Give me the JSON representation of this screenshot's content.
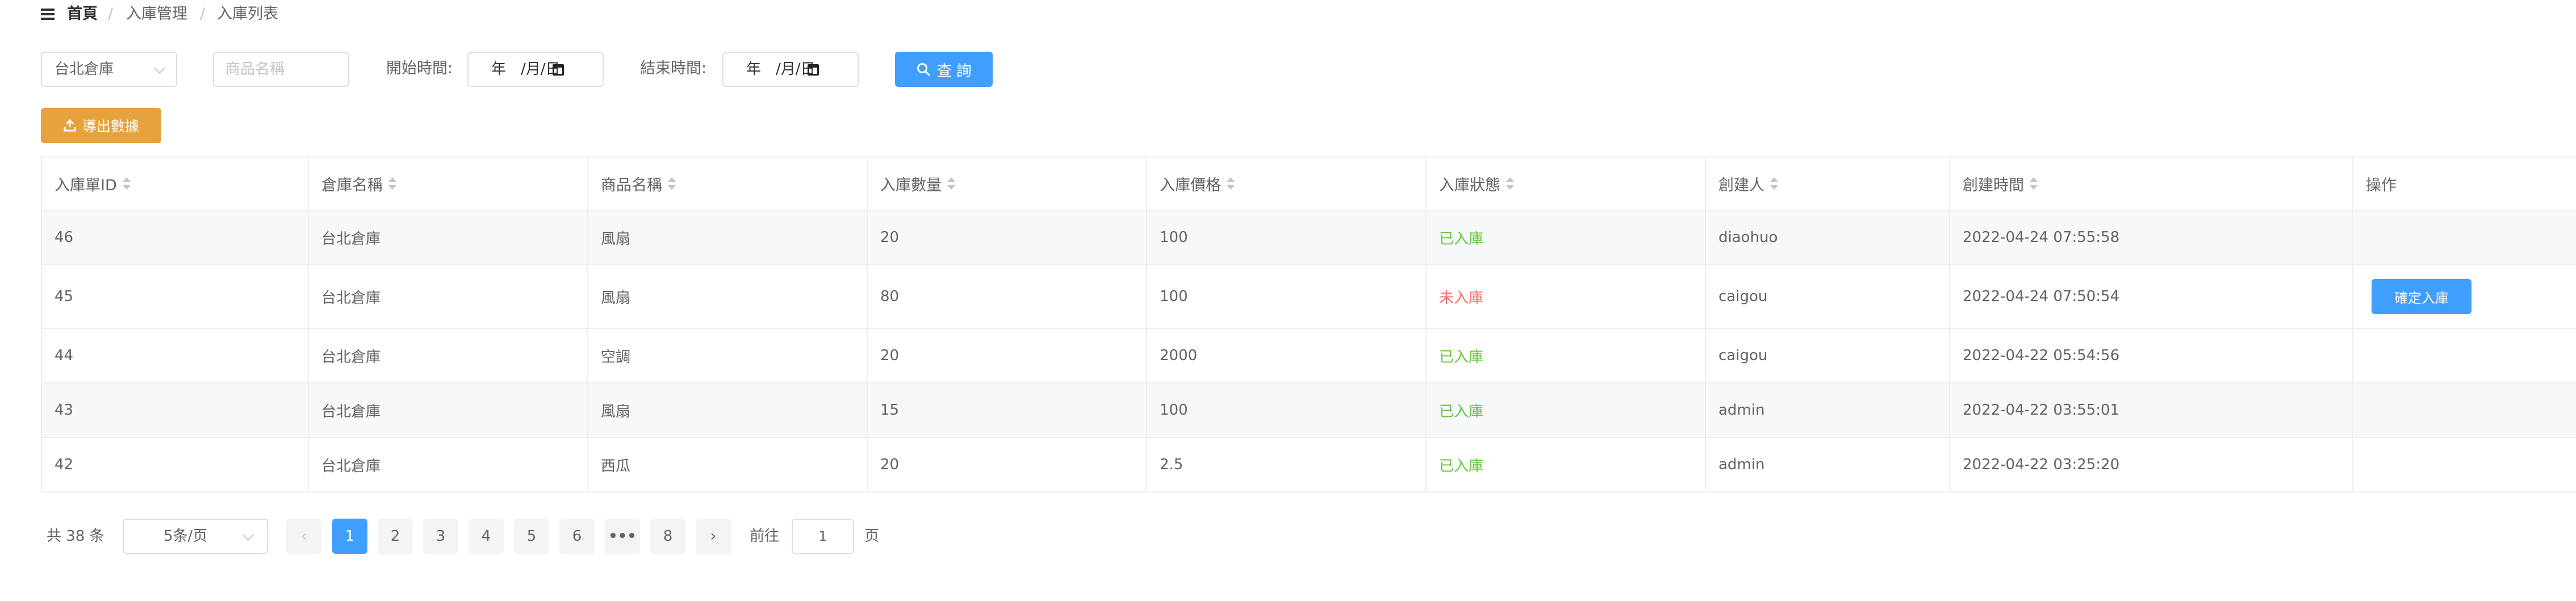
{
  "breadcrumb": {
    "home": "首頁",
    "sep": "/",
    "section": "入庫管理",
    "current": "入庫列表"
  },
  "filters": {
    "warehouse_value": "台北倉庫",
    "product_placeholder": "商品名稱",
    "start_label": "開始時間:",
    "end_label": "結束時間:",
    "date_placeholder": "年　/月/日",
    "search_label": "查 詢"
  },
  "export_label": "導出數據",
  "table": {
    "headers": [
      "入庫單ID",
      "倉庫名稱",
      "商品名稱",
      "入庫數量",
      "入庫價格",
      "入庫狀態",
      "創建人",
      "創建時間",
      "操作"
    ],
    "rows": [
      {
        "id": "46",
        "warehouse": "台北倉庫",
        "product": "風扇",
        "qty": "20",
        "price": "100",
        "status": "已入庫",
        "creator": "diaohuo",
        "created": "2022-04-24 07:55:58",
        "action": ""
      },
      {
        "id": "45",
        "warehouse": "台北倉庫",
        "product": "風扇",
        "qty": "80",
        "price": "100",
        "status": "未入庫",
        "creator": "caigou",
        "created": "2022-04-24 07:50:54",
        "action": "確定入庫"
      },
      {
        "id": "44",
        "warehouse": "台北倉庫",
        "product": "空調",
        "qty": "20",
        "price": "2000",
        "status": "已入庫",
        "creator": "caigou",
        "created": "2022-04-22 05:54:56",
        "action": ""
      },
      {
        "id": "43",
        "warehouse": "台北倉庫",
        "product": "風扇",
        "qty": "15",
        "price": "100",
        "status": "已入庫",
        "creator": "admin",
        "created": "2022-04-22 03:55:01",
        "action": ""
      },
      {
        "id": "42",
        "warehouse": "台北倉庫",
        "product": "西瓜",
        "qty": "20",
        "price": "2.5",
        "status": "已入庫",
        "creator": "admin",
        "created": "2022-04-22 03:25:20",
        "action": ""
      }
    ]
  },
  "pagination": {
    "total": "共 38 条",
    "page_size": "5条/页",
    "prev": "‹",
    "next": "›",
    "pages": [
      "1",
      "2",
      "3",
      "4",
      "5",
      "6",
      "•••",
      "8"
    ],
    "current_page": "1",
    "goto_label": "前往",
    "goto_value": "1",
    "page_suffix": "页"
  },
  "colors": {
    "primary": "#409eff",
    "warning": "#e6a23c",
    "success": "#67c23a",
    "danger": "#f56c6c",
    "border": "#ebeef5"
  },
  "icons": {
    "menu": "hamburger-icon",
    "search": "search-icon",
    "export": "upload-icon",
    "dropdown": "chevron-down-icon",
    "calendar": "calendar-icon",
    "sort": "sort-caret-icon"
  }
}
